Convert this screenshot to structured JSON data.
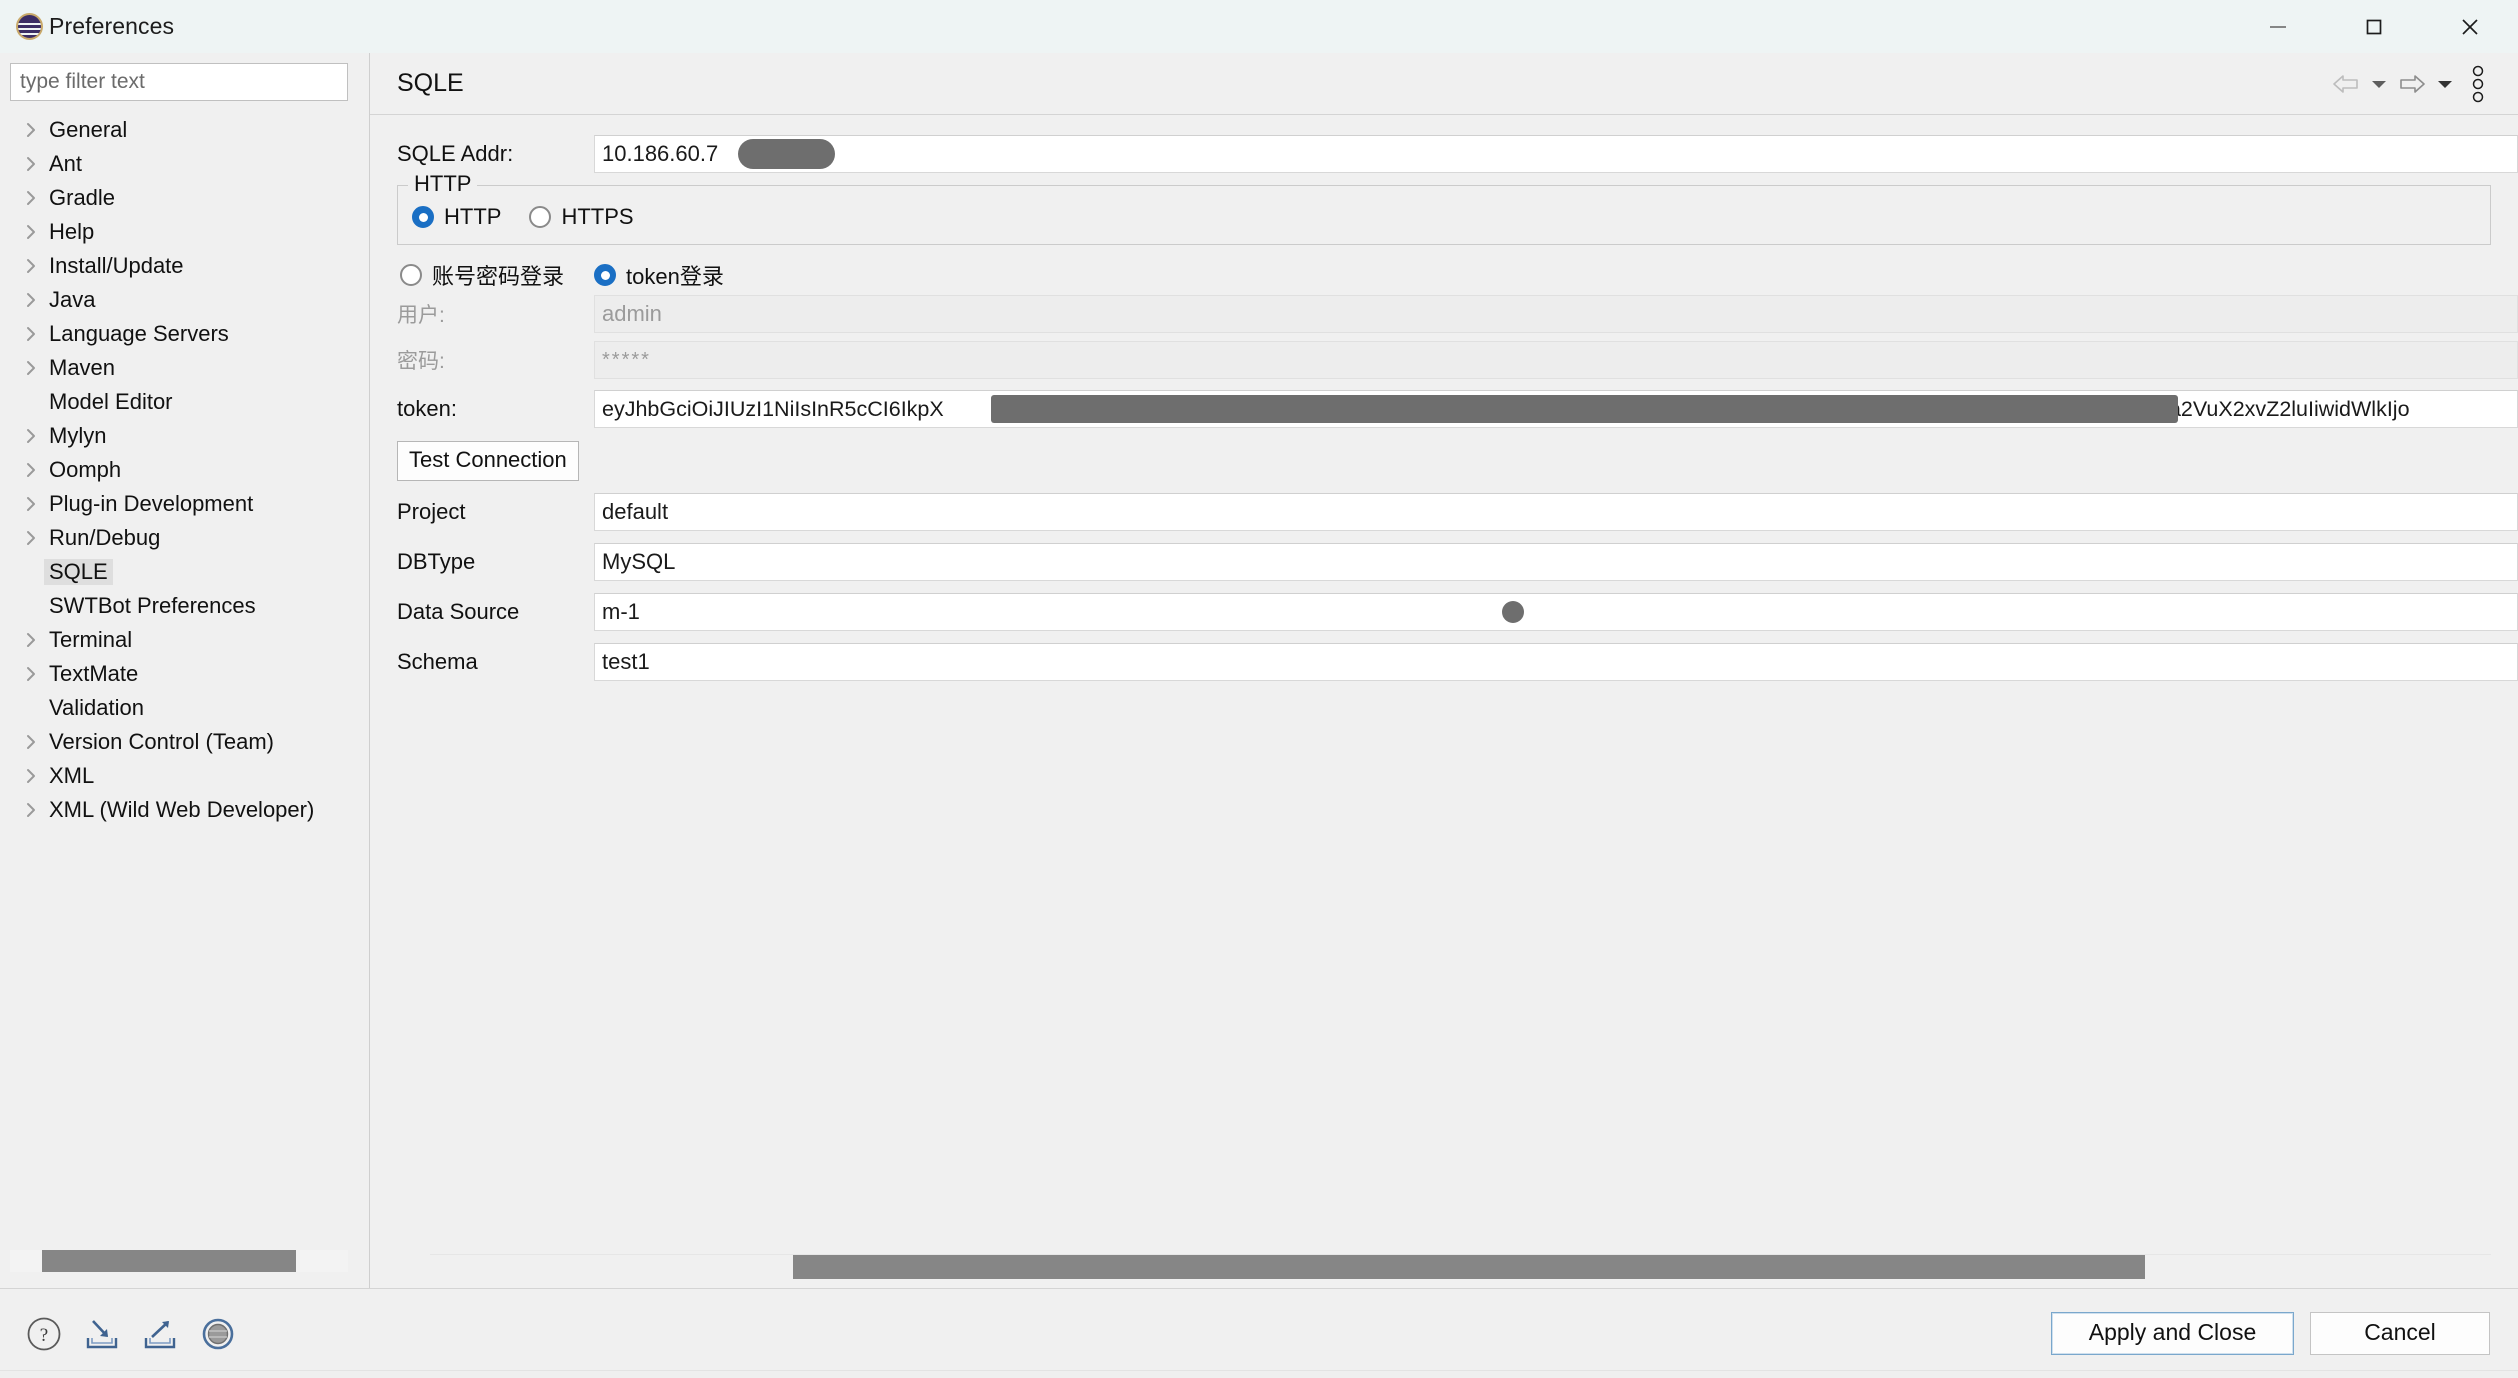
{
  "window": {
    "title": "Preferences",
    "logo_icon": "eclipse-logo",
    "minimize_label": "Minimize",
    "maximize_label": "Maximize",
    "close_label": "Close"
  },
  "sidebar": {
    "filter_placeholder": "type filter text",
    "filter_value": "",
    "items": [
      {
        "label": "General",
        "expandable": true,
        "selected": false
      },
      {
        "label": "Ant",
        "expandable": true,
        "selected": false
      },
      {
        "label": "Gradle",
        "expandable": true,
        "selected": false
      },
      {
        "label": "Help",
        "expandable": true,
        "selected": false
      },
      {
        "label": "Install/Update",
        "expandable": true,
        "selected": false
      },
      {
        "label": "Java",
        "expandable": true,
        "selected": false
      },
      {
        "label": "Language Servers",
        "expandable": true,
        "selected": false
      },
      {
        "label": "Maven",
        "expandable": true,
        "selected": false
      },
      {
        "label": "Model Editor",
        "expandable": false,
        "selected": false
      },
      {
        "label": "Mylyn",
        "expandable": true,
        "selected": false
      },
      {
        "label": "Oomph",
        "expandable": true,
        "selected": false
      },
      {
        "label": "Plug-in Development",
        "expandable": true,
        "selected": false
      },
      {
        "label": "Run/Debug",
        "expandable": true,
        "selected": false
      },
      {
        "label": "SQLE",
        "expandable": false,
        "selected": true
      },
      {
        "label": "SWTBot Preferences",
        "expandable": false,
        "selected": false
      },
      {
        "label": "Terminal",
        "expandable": true,
        "selected": false
      },
      {
        "label": "TextMate",
        "expandable": true,
        "selected": false
      },
      {
        "label": "Validation",
        "expandable": false,
        "selected": false
      },
      {
        "label": "Version Control (Team)",
        "expandable": true,
        "selected": false
      },
      {
        "label": "XML",
        "expandable": true,
        "selected": false
      },
      {
        "label": "XML (Wild Web Developer)",
        "expandable": true,
        "selected": false
      }
    ]
  },
  "main": {
    "title": "SQLE",
    "tools": {
      "back_label": "Back",
      "back_menu_label": "Back history",
      "forward_label": "Forward",
      "forward_menu_label": "Forward history",
      "view_menu_label": "View menu"
    },
    "addr": {
      "label": "SQLE Addr:",
      "value": "10.186.60.7",
      "redacted": true
    },
    "protocol_group": {
      "title": "HTTP",
      "options": [
        {
          "label": "HTTP",
          "checked": true
        },
        {
          "label": "HTTPS",
          "checked": false
        }
      ]
    },
    "auth_mode": {
      "options": [
        {
          "label": "账号密码登录",
          "checked": false
        },
        {
          "label": "token登录",
          "checked": true
        }
      ]
    },
    "user": {
      "label": "用户:",
      "value": "admin",
      "disabled": true
    },
    "password": {
      "label": "密码:",
      "value": "*****",
      "disabled": true
    },
    "token": {
      "label": "token:",
      "value_start": "eyJhbGciOiJIUzI1NiIsInR5cCI6IkpX",
      "value_end": "3Rva2VuX2xvZ2luIiwidWlkIjo",
      "redacted": true
    },
    "test_button": "Test Connection",
    "fields": [
      {
        "label": "Project",
        "value": "default",
        "redacted": false
      },
      {
        "label": "DBType",
        "value": "MySQL",
        "redacted": false
      },
      {
        "label": "Data Source",
        "value": "m-1",
        "redacted": true
      },
      {
        "label": "Schema",
        "value": "test1",
        "redacted": false
      }
    ]
  },
  "footer": {
    "icons": [
      {
        "name": "help-icon",
        "label": "Help"
      },
      {
        "name": "import-icon",
        "label": "Import Preferences"
      },
      {
        "name": "export-icon",
        "label": "Export Preferences"
      },
      {
        "name": "record-icon",
        "label": "Record Preferences"
      }
    ],
    "apply_label": "Apply and Close",
    "cancel_label": "Cancel"
  },
  "colors": {
    "titlebar_bg": "#eef4f4",
    "dialog_bg": "#f0f0f0",
    "accent_radio": "#1a6fc4",
    "redaction": "#6e6e6e",
    "selection_bg": "#dedede",
    "scrollbar_thumb": "#868686"
  }
}
